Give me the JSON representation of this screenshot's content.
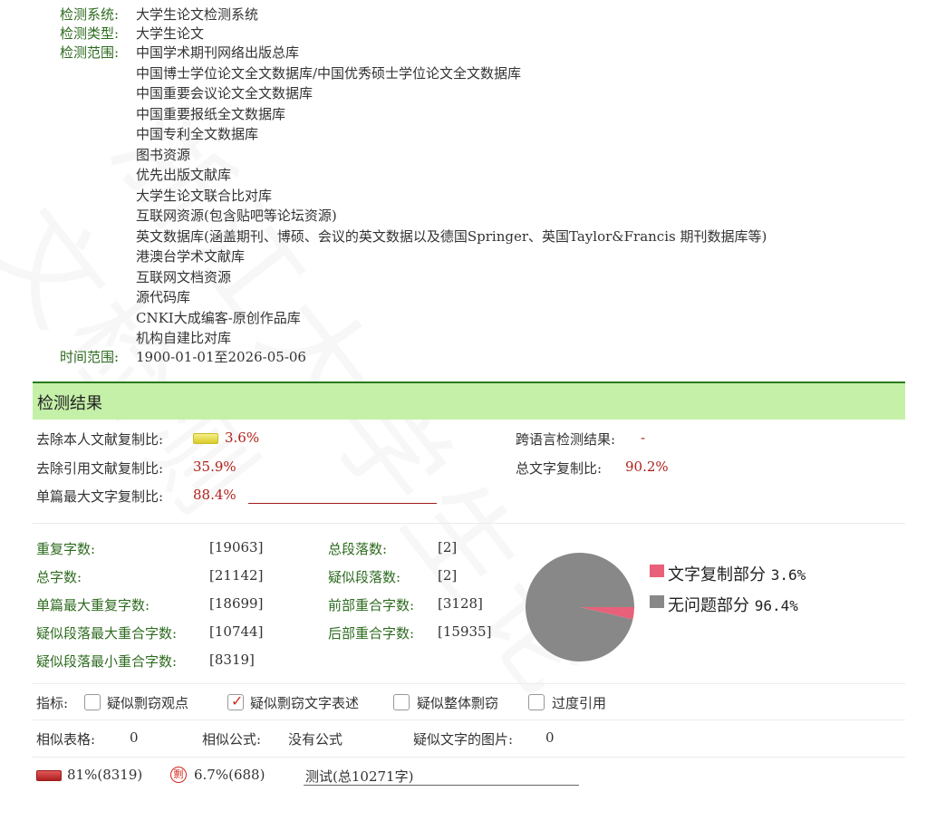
{
  "info": {
    "system_label": "检测系统:",
    "system_value": "大学生论文检测系统",
    "type_label": "检测类型:",
    "type_value": "大学生论文",
    "scope_label": "检测范围:",
    "scope_items": [
      "中国学术期刊网络出版总库",
      "中国博士学位论文全文数据库/中国优秀硕士学位论文全文数据库",
      "中国重要会议论文全文数据库",
      "中国重要报纸全文数据库",
      "中国专利全文数据库",
      "图书资源",
      "优先出版文献库",
      "大学生论文联合比对库",
      "互联网资源(包含贴吧等论坛资源)",
      "英文数据库(涵盖期刊、博硕、会议的英文数据以及德国Springer、英国Taylor&Francis 期刊数据库等)",
      "港澳台学术文献库",
      "互联网文档资源",
      "源代码库",
      "CNKI大成编客-原创作品库",
      "机构自建比对库"
    ],
    "time_label": "时间范围:",
    "time_value": "1900-01-01至2026-05-06"
  },
  "result": {
    "title": "检测结果",
    "self_excl_label": "去除本人文献复制比:",
    "self_excl_value": "3.6%",
    "cross_lang_label": "跨语言检测结果:",
    "cross_lang_value": "-",
    "quote_excl_label": "去除引用文献复制比:",
    "quote_excl_value": "35.9%",
    "total_ratio_label": "总文字复制比:",
    "total_ratio_value": "90.2%",
    "single_max_label": "单篇最大文字复制比:",
    "single_max_value": "88.4%"
  },
  "stats": {
    "repeat_chars_label": "重复字数:",
    "repeat_chars_value": "[19063]",
    "total_paras_label": "总段落数:",
    "total_paras_value": "[2]",
    "total_chars_label": "总字数:",
    "total_chars_value": "[21142]",
    "suspect_paras_label": "疑似段落数:",
    "suspect_paras_value": "[2]",
    "single_max_repeat_label": "单篇最大重复字数:",
    "single_max_repeat_value": "[18699]",
    "front_overlap_label": "前部重合字数:",
    "front_overlap_value": "[3128]",
    "para_max_overlap_label": "疑似段落最大重合字数:",
    "para_max_overlap_value": "[10744]",
    "back_overlap_label": "后部重合字数:",
    "back_overlap_value": "[15935]",
    "para_min_overlap_label": "疑似段落最小重合字数:",
    "para_min_overlap_value": "[8319]"
  },
  "pie": {
    "slices": [
      {
        "label": "文字复制部分",
        "value_text": "3.6%",
        "value": 3.6,
        "color": "#e8607a"
      },
      {
        "label": "无问题部分",
        "value_text": "96.4%",
        "value": 96.4,
        "color": "#888888"
      }
    ]
  },
  "indicators": {
    "label": "指标:",
    "items": [
      {
        "label": "疑似剽窃观点",
        "checked": false
      },
      {
        "label": "疑似剽窃文字表述",
        "checked": true
      },
      {
        "label": "疑似整体剽窃",
        "checked": false
      },
      {
        "label": "过度引用",
        "checked": false
      }
    ]
  },
  "misc": {
    "tables_label": "相似表格:",
    "tables_value": "0",
    "formula_label": "相似公式:",
    "formula_value": "没有公式",
    "images_label": "疑似文字的图片:",
    "images_value": "0"
  },
  "bottom": {
    "red_bar_text": "81%(8319)",
    "anti_text": "6.7%(688)",
    "anti_icon": "剽",
    "doc_text": "测试(总10271字)"
  },
  "watermark": "浙江大学生论文检测"
}
